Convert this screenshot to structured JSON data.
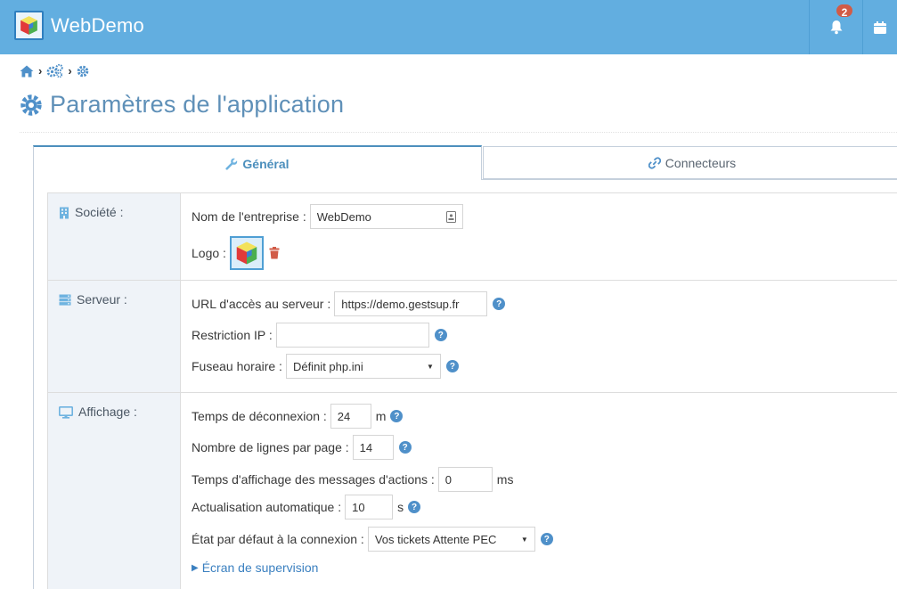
{
  "navbar": {
    "brand": "WebDemo",
    "notification_count": "2",
    "colors": {
      "bar": "#62aee0",
      "badge": "#d15b47"
    }
  },
  "breadcrumb": {
    "items": [
      "home-icon",
      "cogs-icon",
      "cog-icon"
    ]
  },
  "page": {
    "title": "Paramètres de l'application"
  },
  "tabs": [
    {
      "label": "Général",
      "icon": "wrench-icon",
      "active": true
    },
    {
      "label": "Connecteurs",
      "icon": "link-icon",
      "active": false
    }
  ],
  "sections": {
    "societe": {
      "label": "Société :",
      "company_label": "Nom de l'entreprise :",
      "company_value": "WebDemo",
      "logo_label": "Logo :"
    },
    "serveur": {
      "label": "Serveur :",
      "url_label": "URL d'accès au serveur :",
      "url_value": "https://demo.gestsup.fr",
      "ip_label": "Restriction IP :",
      "ip_value": "",
      "tz_label": "Fuseau horaire :",
      "tz_value": "Définit php.ini"
    },
    "affichage": {
      "label": "Affichage :",
      "timeout_label": "Temps de déconnexion :",
      "timeout_value": "24",
      "timeout_unit": "m",
      "rows_label": "Nombre de lignes par page :",
      "rows_value": "14",
      "msg_label": "Temps d'affichage des messages d'actions :",
      "msg_value": "0",
      "msg_unit": "ms",
      "refresh_label": "Actualisation automatique :",
      "refresh_value": "10",
      "refresh_unit": "s",
      "state_label": "État par défaut à la connexion :",
      "state_value": "Vos tickets Attente PEC",
      "supervision_link": "Écran de supervision"
    }
  }
}
